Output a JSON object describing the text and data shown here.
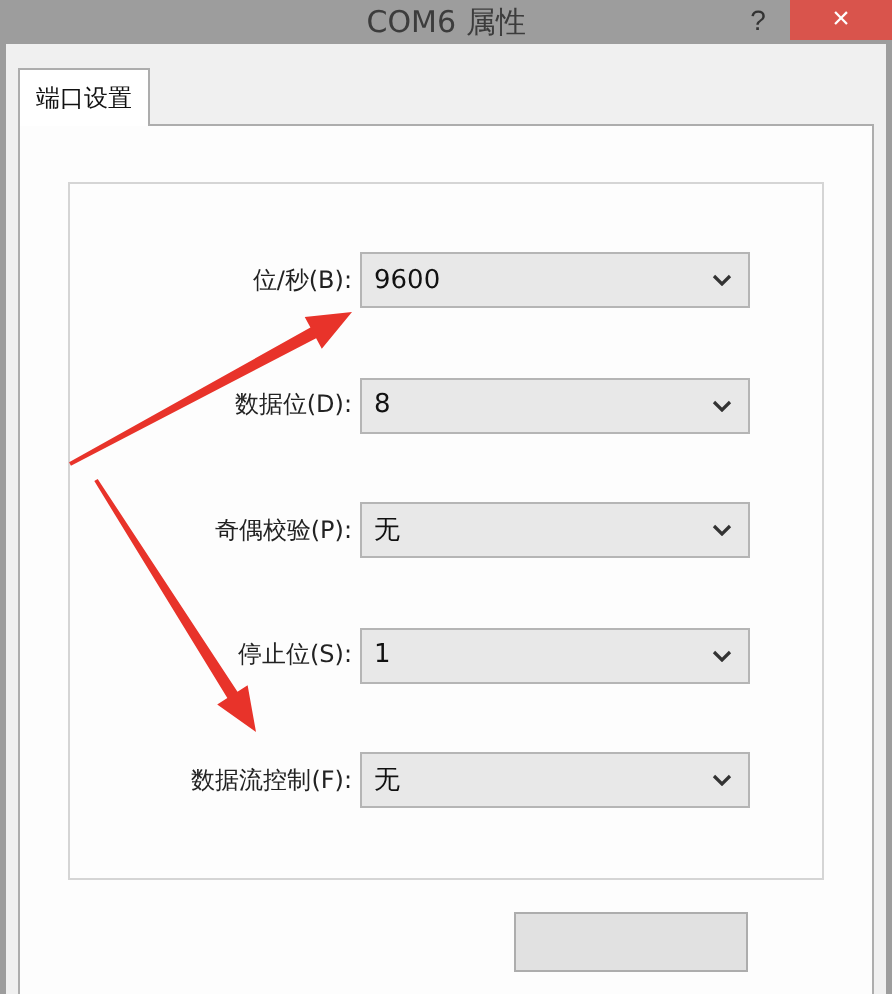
{
  "window": {
    "title": "COM6 属性",
    "help": "?",
    "close": "×"
  },
  "tabs": [
    {
      "label": "端口设置",
      "selected": true
    }
  ],
  "settings": [
    {
      "label": "位/秒(B):",
      "value": "9600"
    },
    {
      "label": "数据位(D):",
      "value": "8"
    },
    {
      "label": "奇偶校验(P):",
      "value": "无"
    },
    {
      "label": "停止位(S):",
      "value": "1"
    },
    {
      "label": "数据流控制(F):",
      "value": "无"
    }
  ],
  "footer_button": {
    "disabled": false
  }
}
